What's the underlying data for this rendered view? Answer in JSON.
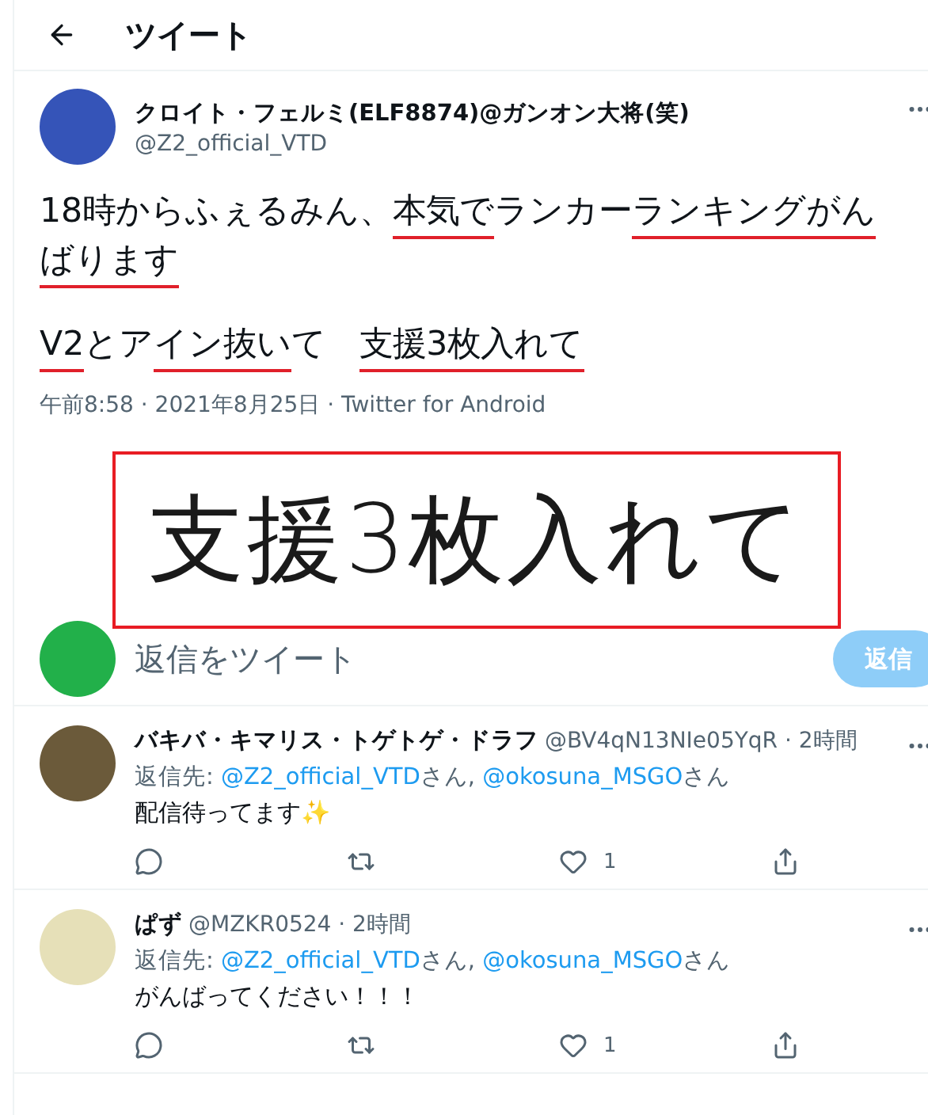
{
  "header": {
    "title": "ツイート"
  },
  "tweet": {
    "author": {
      "name": "クロイト・フェルミ(ELF8874)@ガンオン大将(笑)",
      "handle": "@Z2_official_VTD"
    },
    "paragraphs": [
      [
        {
          "text": "18時からふぇるみん、",
          "underlined": false
        },
        {
          "text": "本気で",
          "underlined": true
        },
        {
          "text": "ランカー",
          "underlined": false
        },
        {
          "text": "ランキングがんばります",
          "underlined": true
        }
      ],
      [
        {
          "text": "V2",
          "underlined": true
        },
        {
          "text": "とア",
          "underlined": false
        },
        {
          "text": "イン抜い",
          "underlined": true
        },
        {
          "text": "て　",
          "underlined": false
        },
        {
          "text": "支援3枚入れて",
          "underlined": true
        }
      ]
    ],
    "timestamp": "午前8:58 · 2021年8月25日 · Twitter for Android",
    "image_text": "支援3枚入れて"
  },
  "reply_box": {
    "placeholder": "返信をツイート",
    "button": {
      "label": "返信",
      "disabled": true
    }
  },
  "replies": [
    {
      "name": "バキバ・キマリス・トゲトゲ・ドラフ",
      "handle": "@BV4qN13NIe05YqR · 2時間",
      "reply_label": "返信先:",
      "mentions": [
        {
          "handle": "@Z2_official_VTD",
          "suffix": "さん, "
        },
        {
          "handle": "@okosuna_MSGO",
          "suffix": "さん"
        }
      ],
      "body": "配信待ってます✨",
      "actions": [
        {
          "kind": "reply"
        },
        {
          "kind": "retweet"
        },
        {
          "kind": "like",
          "count": "1"
        },
        {
          "kind": "share"
        }
      ]
    },
    {
      "name": "ぱず",
      "handle": "@MZKR0524 · 2時間",
      "reply_label": "返信先:",
      "mentions": [
        {
          "handle": "@Z2_official_VTD",
          "suffix": "さん, "
        },
        {
          "handle": "@okosuna_MSGO",
          "suffix": "さん"
        }
      ],
      "body": "がんばってください！！！",
      "actions": [
        {
          "kind": "reply"
        },
        {
          "kind": "retweet"
        },
        {
          "kind": "like",
          "count": "1"
        },
        {
          "kind": "share"
        }
      ]
    }
  ]
}
